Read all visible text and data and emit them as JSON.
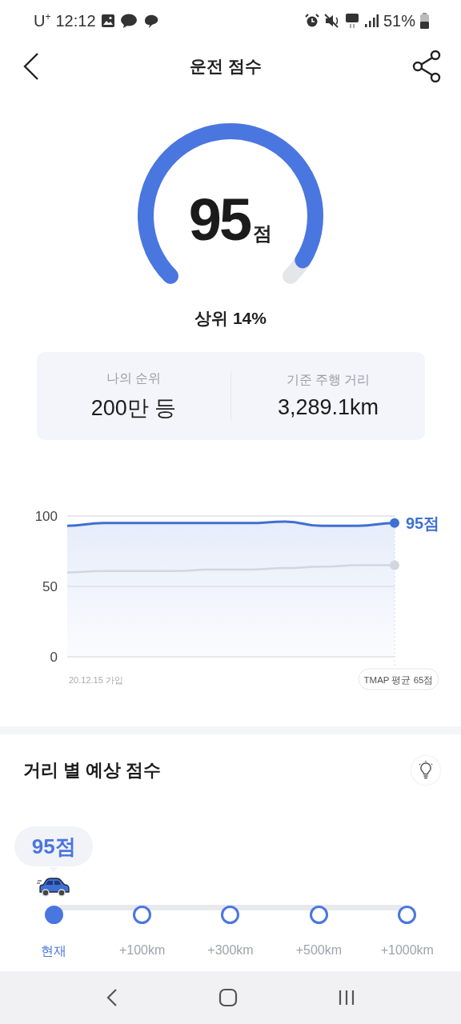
{
  "status_bar": {
    "carrier": "U$^{+}$",
    "time": "12:12",
    "battery": "51%"
  },
  "header": {
    "title": "운전 점수"
  },
  "gauge": {
    "score": "95",
    "unit": "점",
    "rank_text": "상위 14%"
  },
  "stats": [
    {
      "label": "나의 순위",
      "value": "200만 등"
    },
    {
      "label": "기준 주행 거리",
      "value": "3,289.1km"
    }
  ],
  "chart": {
    "chart_data": {
      "type": "line",
      "series": [
        {
          "color": "#3f6fd3",
          "values": [
            93,
            95,
            95,
            95,
            95,
            95,
            96,
            93,
            93,
            95
          ]
        },
        {
          "color": "#d2d6de",
          "values": [
            60,
            61,
            61,
            61,
            62,
            62,
            63,
            64,
            65,
            65
          ]
        }
      ],
      "ylim": [
        0,
        100
      ],
      "yticks": [
        0,
        50,
        100
      ]
    },
    "end_label": "95점",
    "start_label": "20.12.15 가입",
    "average_badge": "TMAP 평균 65점"
  },
  "forecast": {
    "title": "거리 별 예상 점수",
    "bubble": "95점",
    "steps": [
      {
        "label": "현재",
        "selected": true
      },
      {
        "label": "+100km",
        "selected": false
      },
      {
        "label": "+300km",
        "selected": false
      },
      {
        "label": "+500km",
        "selected": false
      },
      {
        "label": "+1000km",
        "selected": false
      }
    ]
  }
}
